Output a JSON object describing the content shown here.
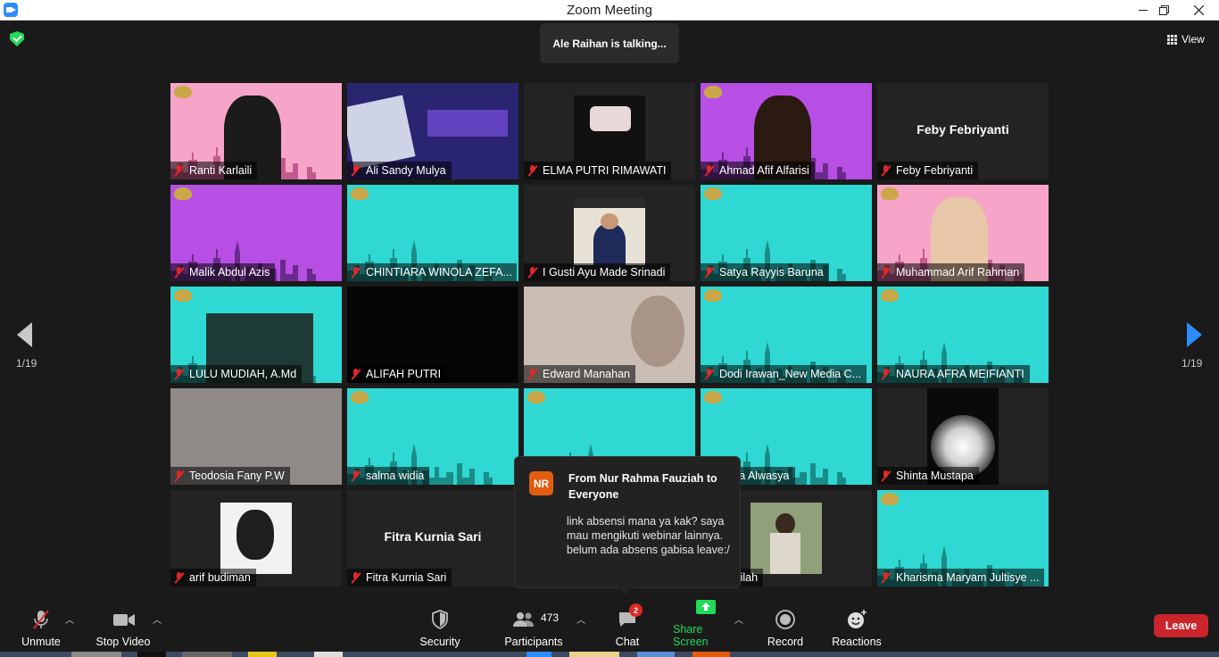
{
  "window": {
    "title": "Zoom Meeting",
    "controls": [
      "minimize",
      "maximize",
      "close"
    ]
  },
  "meeting": {
    "talking": "Ale Raihan is talking...",
    "view_label": "View",
    "page_left": "1/19",
    "page_right": "1/19"
  },
  "colors": {
    "accent": "#2d8cff",
    "pink_slide": "#f4a6c9",
    "purple_slide": "#b052e0",
    "teal_slide": "#2ad8d2",
    "leave": "#c9252b",
    "share_green": "#23d959"
  },
  "participants": [
    {
      "name": "Ranti Karlaili",
      "bg": "pink",
      "video": true
    },
    {
      "name": "Ali Sandy Mulya",
      "bg": "uki",
      "video": true
    },
    {
      "name": "ELMA PUTRI RIMAWATI",
      "bg": "photo-small",
      "video": true
    },
    {
      "name": "Ahmad Afif Alfarisi",
      "bg": "purple",
      "video": true
    },
    {
      "name": "Feby Febriyanti",
      "bg": "name",
      "display": "Feby Febriyanti",
      "video": false
    },
    {
      "name": "Malik Abdul Azis",
      "bg": "purple",
      "video": true
    },
    {
      "name": "CHINTIARA WINOLA ZEFA...",
      "bg": "teal",
      "video": true
    },
    {
      "name": "I Gusti Ayu Made Srinadi",
      "bg": "photo-portrait",
      "video": true
    },
    {
      "name": "Satya Rayyis Baruna",
      "bg": "teal",
      "video": true
    },
    {
      "name": "Muhammad Arif Rahman",
      "bg": "pink",
      "video": true
    },
    {
      "name": "LULU MUDIAH, A.Md",
      "bg": "teal",
      "video": true
    },
    {
      "name": "ALIFAH PUTRI",
      "bg": "black",
      "video": true
    },
    {
      "name": "Edward Manahan",
      "bg": "beige",
      "video": true
    },
    {
      "name": "Dodi Irawan_New Media C...",
      "bg": "teal",
      "video": true
    },
    {
      "name": "NAURA AFRA MEIFIANTI",
      "bg": "teal",
      "video": true
    },
    {
      "name": "Teodosia Fany P.W",
      "bg": "gray",
      "video": true
    },
    {
      "name": "salma widia",
      "bg": "teal",
      "video": true
    },
    {
      "name": "",
      "bg": "teal",
      "video": true
    },
    {
      "name": "i Dea Alwasya",
      "bg": "teal",
      "video": true
    },
    {
      "name": "Shinta Mustapa",
      "bg": "dark-cam",
      "video": true
    },
    {
      "name": "arif budiman",
      "bg": "photo-bw",
      "video": true
    },
    {
      "name": "Fitra Kurnia Sari",
      "bg": "name",
      "display": "Fitra Kurnia Sari",
      "video": false
    },
    {
      "name": "",
      "bg": "dark",
      "video": true
    },
    {
      "name": "i Aldilah",
      "bg": "photo-outdoor",
      "video": true
    },
    {
      "name": "Kharisma Maryam Jultisye ...",
      "bg": "teal",
      "video": true
    }
  ],
  "chat_popup": {
    "avatar": "NR",
    "from": "From Nur Rahma Fauziah to Everyone",
    "message": "link absensi mana ya kak? saya mau mengikuti webinar lainnya. belum ada absens gabisa leave:/"
  },
  "toolbar": {
    "unmute": "Unmute",
    "stop_video": "Stop Video",
    "security": "Security",
    "participants": "Participants",
    "participants_count": "473",
    "chat": "Chat",
    "chat_badge": "2",
    "share_screen": "Share Screen",
    "record": "Record",
    "reactions": "Reactions",
    "leave": "Leave"
  }
}
